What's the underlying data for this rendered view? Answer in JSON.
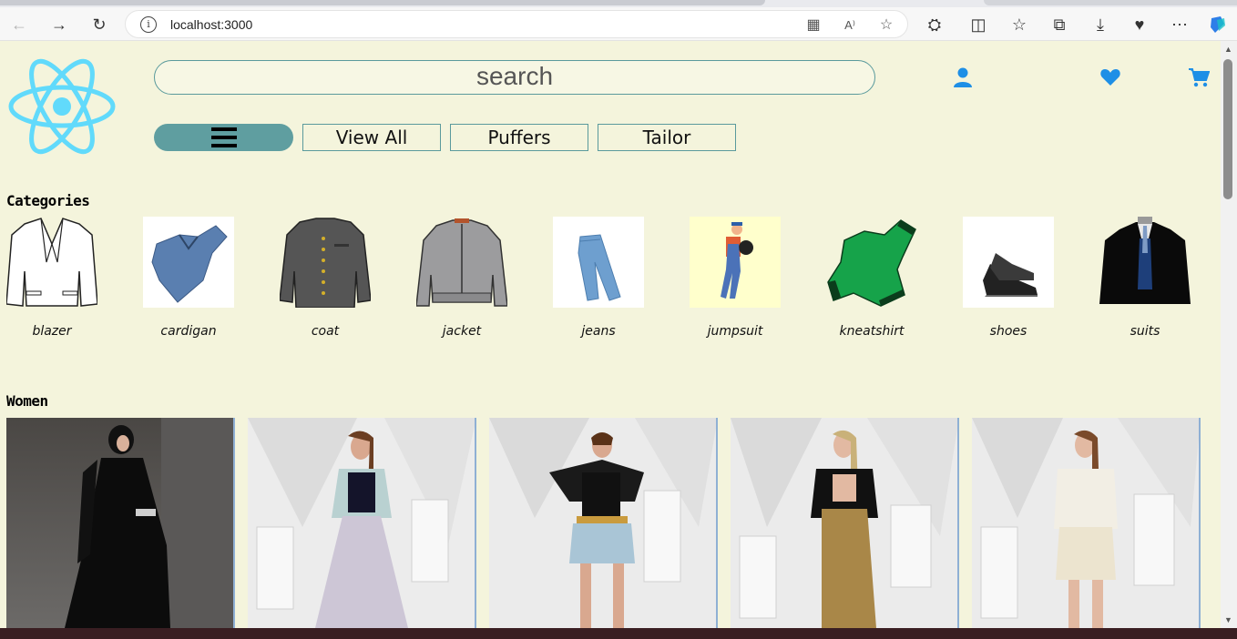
{
  "browser": {
    "url": "localhost:3000",
    "icons": [
      "back-icon",
      "forward-icon",
      "refresh-icon",
      "info-icon",
      "apps-icon",
      "read-aloud-icon",
      "favorite-star-icon",
      "extensions-icon",
      "split-screen-icon",
      "favorites-icon",
      "collections-icon",
      "downloads-icon",
      "performance-icon",
      "more-icon",
      "copilot-icon"
    ],
    "read_aloud_label": "A⁾"
  },
  "header": {
    "search_placeholder": "search",
    "icons": [
      "user-icon",
      "heart-icon",
      "cart-icon"
    ],
    "accent_color": "#1e8fe6",
    "nav": {
      "menu_icon": "hamburger-icon",
      "buttons": [
        "View All",
        "Puffers",
        "Tailor"
      ]
    }
  },
  "categories": {
    "title": "Categories",
    "items": [
      {
        "label": "blazer",
        "icon": "blazer-icon"
      },
      {
        "label": "cardigan",
        "icon": "cardigan-icon"
      },
      {
        "label": "coat",
        "icon": "coat-icon"
      },
      {
        "label": "jacket",
        "icon": "jacket-icon"
      },
      {
        "label": "jeans",
        "icon": "jeans-icon"
      },
      {
        "label": "jumpsuit",
        "icon": "jumpsuit-icon"
      },
      {
        "label": "kneatshirt",
        "icon": "kneatshirt-icon"
      },
      {
        "label": "shoes",
        "icon": "shoes-icon"
      },
      {
        "label": "suits",
        "icon": "suits-icon"
      }
    ]
  },
  "women": {
    "title": "Women",
    "items": [
      {
        "name": "women-product-1",
        "outfit": "black abaya"
      },
      {
        "name": "women-product-2",
        "outfit": "tulle skirt with light jacket"
      },
      {
        "name": "women-product-3",
        "outfit": "cape top with shorts"
      },
      {
        "name": "women-product-4",
        "outfit": "black blazer with gold skirt"
      },
      {
        "name": "women-product-5",
        "outfit": "white skirt suit"
      }
    ]
  },
  "colors": {
    "page_bg": "#f4f4dc",
    "button_teal": "#5f9ea0",
    "react_blue": "#61dafb"
  }
}
